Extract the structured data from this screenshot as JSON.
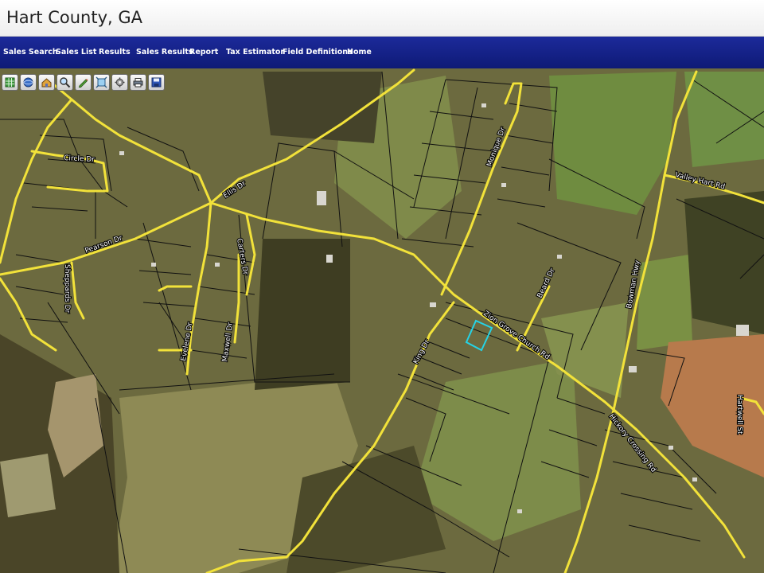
{
  "app": {
    "title": "Hart County, GA"
  },
  "nav": {
    "items": [
      {
        "label": "Sales Search"
      },
      {
        "label": "Sales List"
      },
      {
        "label": "Results"
      },
      {
        "label": "Sales Results"
      },
      {
        "label": "Report"
      },
      {
        "label": "Tax Estimator"
      },
      {
        "label": "Field Definitions"
      },
      {
        "label": "Home"
      }
    ]
  },
  "toolbar": {
    "tools": [
      {
        "icon": "layers-icon"
      },
      {
        "icon": "globe-icon"
      },
      {
        "icon": "parcel-identify-icon"
      },
      {
        "icon": "zoom-icon"
      },
      {
        "icon": "measure-pencil-icon"
      },
      {
        "icon": "full-extent-icon"
      },
      {
        "icon": "settings-icon"
      },
      {
        "icon": "print-icon"
      },
      {
        "icon": "save-icon"
      }
    ]
  },
  "map": {
    "road_labels": [
      {
        "text": "Circle Dr"
      },
      {
        "text": "Ellis Dr"
      },
      {
        "text": "Pearson Dr"
      },
      {
        "text": "Carters Dr"
      },
      {
        "text": "Sheppards Dr"
      },
      {
        "text": "Evelene Dr"
      },
      {
        "text": "Maxwell Dr"
      },
      {
        "text": "Monique Dr"
      },
      {
        "text": "Valley Hart Rd"
      },
      {
        "text": "Bowman Hwy"
      },
      {
        "text": "King Dr"
      },
      {
        "text": "Zion Grove Church Rd"
      },
      {
        "text": "Beard Dr"
      },
      {
        "text": "Hickory Crossing Rd"
      },
      {
        "text": "Hartwell St"
      }
    ],
    "colors": {
      "road": "#f2e23a",
      "parcel_line": "#111111",
      "selected_parcel": "#25d3e6",
      "pasture": "#8a8651",
      "forest": "#3d3c22"
    }
  }
}
